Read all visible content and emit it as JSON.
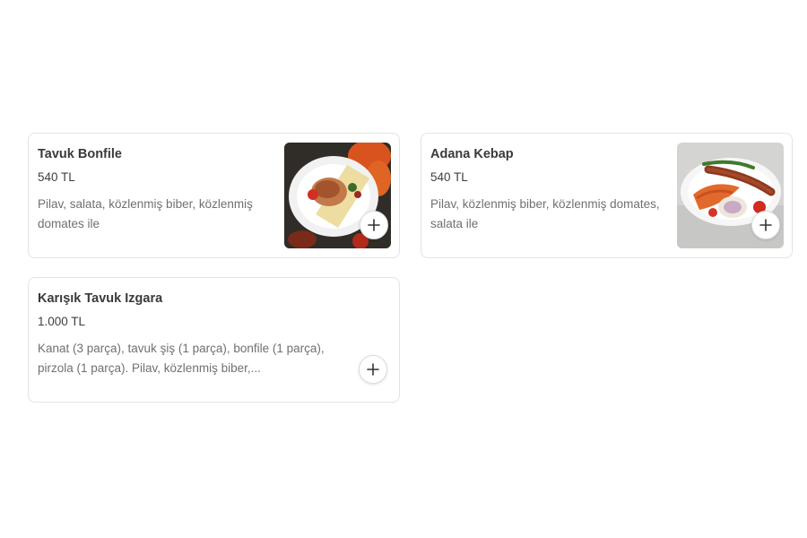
{
  "menu": {
    "items": [
      {
        "title": "Tavuk Bonfile",
        "price": "540 TL",
        "description": "Pilav, salata, közlenmiş biber, közlenmiş domates ile",
        "image": "grilled-chicken-plate",
        "add_icon": "plus-icon"
      },
      {
        "title": "Adana Kebap",
        "price": "540 TL",
        "description": "Pilav, közlenmiş biber, közlenmiş domates, salata ile",
        "image": "adana-kebab-plate",
        "add_icon": "plus-icon"
      },
      {
        "title": "Karışık Tavuk Izgara",
        "price": "1.000 TL",
        "description": "Kanat (3 parça), tavuk şiş (1 parça), bonfile (1 parça), pirzola (1 parça). Pilav, közlenmiş biber,...",
        "add_icon": "plus-icon"
      }
    ]
  }
}
